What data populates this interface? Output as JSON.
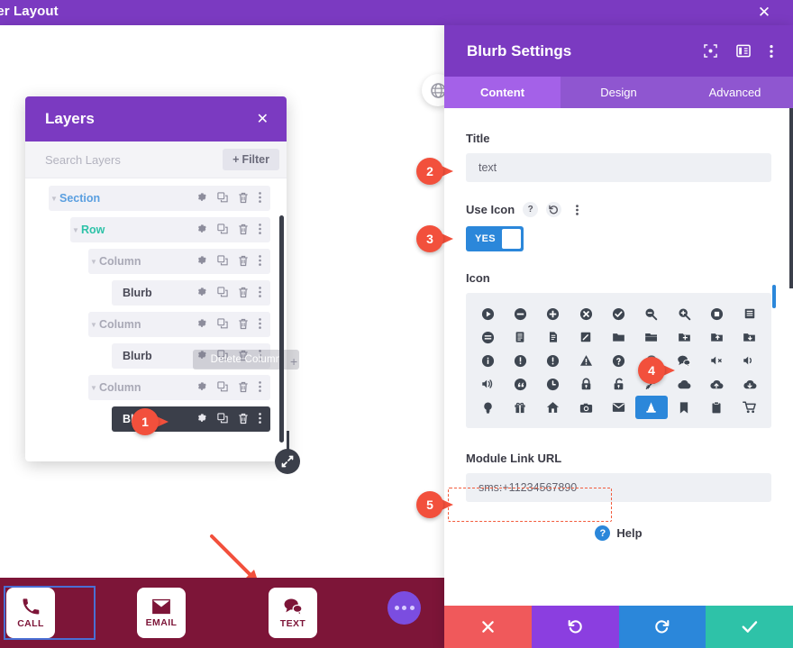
{
  "titlebar": {
    "text": "oter Layout",
    "close_icon": "close-icon"
  },
  "layers_panel": {
    "title": "Layers",
    "close_icon": "close-icon",
    "search_placeholder": "Search Layers",
    "filter_label": "Filter",
    "filter_plus": "+",
    "tooltip": "Delete Column",
    "rows": [
      {
        "label": "Section",
        "indent": 0,
        "caret": true,
        "selected": false
      },
      {
        "label": "Row",
        "indent": 1,
        "caret": true,
        "selected": false
      },
      {
        "label": "Column",
        "indent": 2,
        "caret": true,
        "selected": false
      },
      {
        "label": "Blurb",
        "indent": 3,
        "caret": false,
        "selected": false
      },
      {
        "label": "Column",
        "indent": 2,
        "caret": true,
        "selected": false
      },
      {
        "label": "Blurb",
        "indent": 3,
        "caret": false,
        "selected": false
      },
      {
        "label": "Column",
        "indent": 2,
        "caret": true,
        "selected": false
      },
      {
        "label": "Blurb",
        "indent": 3,
        "caret": false,
        "selected": true
      }
    ],
    "row_actions": [
      "gear-icon",
      "duplicate-icon",
      "trash-icon",
      "kebab-icon"
    ]
  },
  "footer_bar": {
    "buttons": [
      {
        "label": "CALL",
        "icon": "phone-icon"
      },
      {
        "label": "EMAIL",
        "icon": "envelope-icon"
      },
      {
        "label": "TEXT",
        "icon": "chat-bubbles-icon"
      }
    ],
    "more_icon": "ellipsis-icon",
    "bg_color": "#7d1538",
    "selected_outline_color": "#4a6fd4"
  },
  "settings_panel": {
    "title": "Blurb Settings",
    "header_icons": [
      "focus-icon",
      "layout-icon",
      "kebab-icon"
    ],
    "tabs": [
      {
        "label": "Content",
        "active": true
      },
      {
        "label": "Design",
        "active": false
      },
      {
        "label": "Advanced",
        "active": false
      }
    ],
    "title_field": {
      "label": "Title",
      "value": "text"
    },
    "use_icon_field": {
      "label": "Use Icon",
      "help_icon": "question-icon",
      "reset_icon": "undo-icon",
      "more_icon": "kebab-icon",
      "toggle_value": "YES"
    },
    "icon_field": {
      "label": "Icon",
      "selected_index": 41,
      "selected_color": "#2b87da",
      "icons": [
        "play-circle-icon",
        "minus-circle-icon",
        "plus-circle-icon",
        "times-circle-icon",
        "check-circle-icon",
        "zoom-out-icon",
        "zoom-in-icon",
        "stop-circle-icon",
        "list-icon",
        "menu-circle-icon",
        "document-lines-icon",
        "document-icon",
        "pencil-box-icon",
        "folder-icon",
        "folder-open-icon",
        "folder-add-icon",
        "folder-up-icon",
        "folder-down-icon",
        "info-circle-icon",
        "exclamation-circle-icon",
        "alert-circle-icon",
        "warning-triangle-icon",
        "question-circle-icon",
        "placeholder-icon",
        "chat-bubbles-icon",
        "volume-mute-icon",
        "volume-up-icon",
        "speaker-icon",
        "quote-circle-icon",
        "clock-icon",
        "lock-icon",
        "unlock-icon",
        "key-icon",
        "cloud-icon",
        "cloud-upload-icon",
        "cloud-download-icon",
        "lightbulb-icon",
        "gift-icon",
        "home-icon",
        "camera-icon",
        "mail-icon",
        "cone-icon",
        "bookmark-icon",
        "clipboard-icon",
        "cart-icon"
      ]
    },
    "module_link_field": {
      "label": "Module Link URL",
      "value": "sms:+11234567890",
      "highlight_color": "#f25c3d"
    },
    "help": {
      "label": "Help",
      "icon": "question-circle-icon"
    },
    "actions": [
      {
        "name": "cancel",
        "icon": "times-icon",
        "color": "#f0595b"
      },
      {
        "name": "undo",
        "icon": "undo-icon",
        "color": "#8b3ee0"
      },
      {
        "name": "redo",
        "icon": "redo-icon",
        "color": "#2b87da"
      },
      {
        "name": "save",
        "icon": "check-icon",
        "color": "#2ec2a8"
      }
    ]
  },
  "callouts": [
    {
      "number": "1"
    },
    {
      "number": "2"
    },
    {
      "number": "3"
    },
    {
      "number": "4"
    },
    {
      "number": "5"
    }
  ]
}
